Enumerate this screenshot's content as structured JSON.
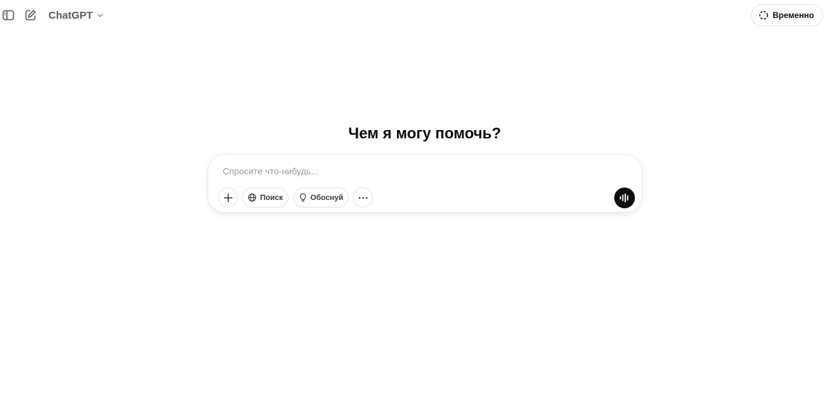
{
  "header": {
    "model_label": "ChatGPT",
    "temporary_label": "Временно"
  },
  "main": {
    "headline": "Чем я могу помочь?"
  },
  "composer": {
    "placeholder": "Спросите что-нибудь...",
    "search_label": "Поиск",
    "reason_label": "Обоснуй"
  },
  "icons": {
    "sidebar": "sidebar-toggle-icon",
    "new_chat": "pencil-square-icon",
    "chevron": "chevron-down-icon",
    "temporary": "dashed-circle-icon",
    "plus": "plus-icon",
    "globe": "globe-icon",
    "bulb": "lightbulb-icon",
    "more": "ellipsis-icon",
    "voice": "voice-waveform-icon"
  },
  "colors": {
    "text": "#0d0d0d",
    "muted": "#5d5d5d",
    "placeholder": "#9b9b9b",
    "border": "#e3e3e3",
    "voice_button": "#0d0d0d"
  }
}
